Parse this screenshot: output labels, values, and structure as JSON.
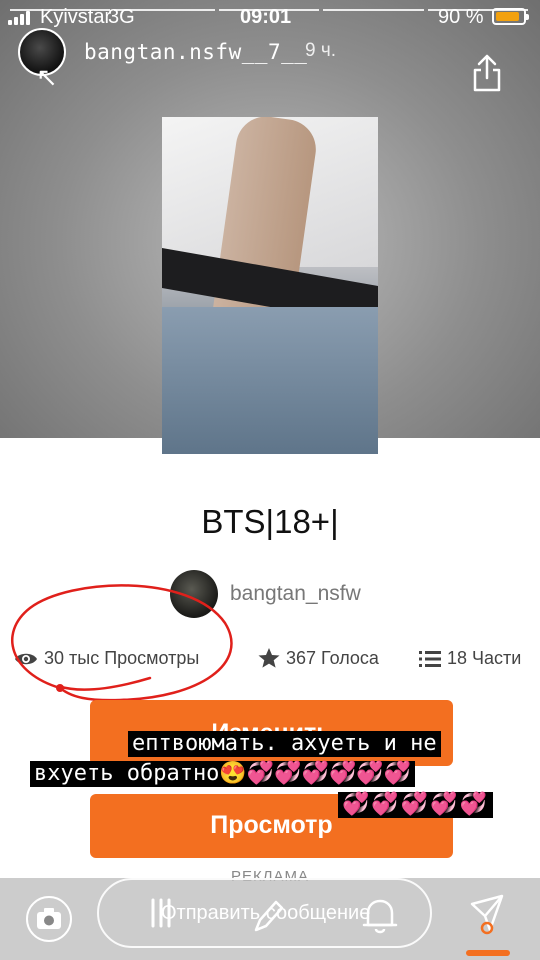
{
  "status_bar": {
    "carrier": "Kyivstar",
    "network": "3G",
    "time": "09:01",
    "battery_percent": "90 %",
    "battery_level": 0.9,
    "battery_color": "#f2a10f"
  },
  "story": {
    "username": "bangtan.nsfw__7__",
    "time_ago": "9 ч."
  },
  "book": {
    "title": "BTS|18+|",
    "author": "bangtan_nsfw",
    "reads": "30 тыс Просмотры",
    "votes": "367 Голоса",
    "parts": "18 Части"
  },
  "buttons": {
    "change_label": "Изменить",
    "view_label": "Просмотр",
    "accent_color": "#f36f20"
  },
  "story_text": {
    "line1": "ептвоюмать. ахуеть и не",
    "line2": "вхуеть обратно😍💞💞💞💞💞💞",
    "line3": "💞💞💞💞💞"
  },
  "ad_label": "РЕКЛАМА",
  "bottom_bar": {
    "message_placeholder": "Отправить сообщение"
  },
  "icons": {
    "share": "share-icon",
    "camera": "camera-icon",
    "pen": "pen-icon",
    "bell": "bell-icon",
    "send": "send-icon",
    "eye": "eye-icon",
    "star": "star-icon",
    "list": "list-icon"
  }
}
